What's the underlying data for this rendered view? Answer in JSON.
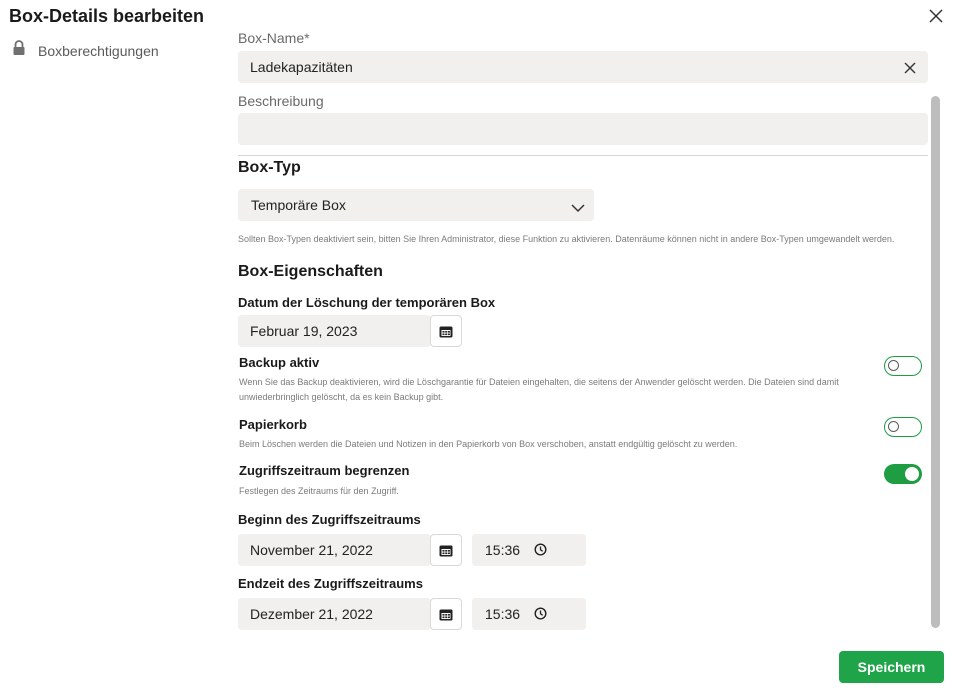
{
  "dialog": {
    "title": "Box-Details bearbeiten",
    "close_icon": "close-icon"
  },
  "sidebar": {
    "items": [
      {
        "label": "Boxberechtigungen",
        "icon": "lock-icon"
      }
    ]
  },
  "form": {
    "box_name": {
      "label": "Box-Name*",
      "value": "Ladekapazitäten"
    },
    "description": {
      "label": "Beschreibung",
      "value": ""
    },
    "box_type": {
      "heading": "Box-Typ",
      "selected": "Temporäre Box",
      "help": "Sollten Box-Typen deaktiviert sein, bitten Sie Ihren Administrator, diese Funktion zu aktivieren. Datenräume können nicht in andere Box-Typen umgewandelt werden."
    },
    "properties": {
      "heading": "Box-Eigenschaften",
      "deletion_date": {
        "label": "Datum der Löschung der temporären Box",
        "value": "Februar 19, 2023"
      },
      "backup": {
        "label": "Backup aktiv",
        "enabled": false,
        "help": "Wenn Sie das Backup deaktivieren, wird die Löschgarantie für Dateien eingehalten, die seitens der Anwender gelöscht werden. Die Dateien sind damit unwiederbringlich gelöscht, da es kein Backup gibt."
      },
      "trash": {
        "label": "Papierkorb",
        "enabled": false,
        "help": "Beim Löschen werden die Dateien und Notizen in den Papierkorb von Box verschoben, anstatt endgültig gelöscht zu werden."
      },
      "access_limit": {
        "label": "Zugriffszeitraum begrenzen",
        "enabled": true,
        "help": "Festlegen des Zeitraums für den Zugriff."
      },
      "access_start": {
        "label": "Beginn des Zugriffszeitraums",
        "date": "November 21, 2022",
        "time": "15:36"
      },
      "access_end": {
        "label": "Endzeit des Zugriffszeitraums",
        "date": "Dezember 21, 2022",
        "time": "15:36"
      }
    }
  },
  "footer": {
    "save_label": "Speichern"
  },
  "colors": {
    "accent": "#1fa44a",
    "input_bg": "#f2f0ee"
  }
}
